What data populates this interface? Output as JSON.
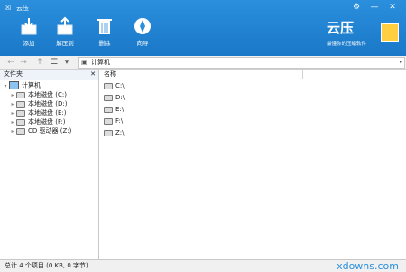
{
  "window": {
    "title": "云压",
    "controls": {
      "settings": "⚙",
      "minimize": "—",
      "close": "✕"
    }
  },
  "toolbar": {
    "items": [
      {
        "label": "添加",
        "icon": "add-archive-icon"
      },
      {
        "label": "解压到",
        "icon": "extract-icon"
      },
      {
        "label": "删除",
        "icon": "delete-icon"
      },
      {
        "label": "向导",
        "icon": "wizard-icon"
      }
    ]
  },
  "brand": {
    "name": "云压",
    "slogan": "最懂你的压缩软件"
  },
  "nav": {
    "back": "←",
    "forward": "→",
    "up": "↑",
    "view": "☰",
    "view_dd": "▾"
  },
  "address": {
    "value": "计算机",
    "dropdown": "▾"
  },
  "folders_panel": {
    "title": "文件夹",
    "close": "✕",
    "root": "计算机",
    "items": [
      {
        "label": "本地磁盘 (C:)"
      },
      {
        "label": "本地磁盘 (D:)"
      },
      {
        "label": "本地磁盘 (E:)"
      },
      {
        "label": "本地磁盘 (F:)"
      },
      {
        "label": "CD 驱动器 (Z:)"
      }
    ]
  },
  "file_list": {
    "columns": [
      "名称"
    ],
    "rows": [
      "C:\\",
      "D:\\",
      "E:\\",
      "F:\\",
      "Z:\\"
    ]
  },
  "status": {
    "text": "总计 4 个项目 (0 KB, 0 字节)"
  },
  "watermark": "xdowns.com"
}
